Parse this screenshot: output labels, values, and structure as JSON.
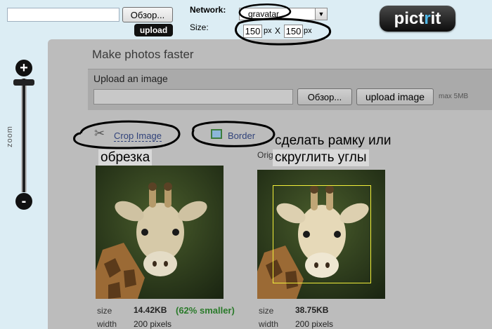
{
  "topbar": {
    "browse_label": "Обзор...",
    "upload_label": "upload",
    "network_label": "Network:",
    "network_value": "gravatar",
    "size_label": "Size:",
    "width_value": "150",
    "height_value": "150",
    "unit": "px",
    "separator": "X"
  },
  "logo": {
    "part1": "pict",
    "accent": "r",
    "part2": "it",
    "accent_color": "#4fb8e8"
  },
  "zoom": {
    "plus": "+",
    "minus": "-",
    "label": "zoom"
  },
  "panel": {
    "title": "Make photos faster",
    "upload_title": "Upload an image",
    "browse_label": "Обзор...",
    "upload_label": "upload image",
    "max_size": "max 5MB",
    "crop_link": "Crop Image",
    "border_link": "Border",
    "annotation_crop": "обрезка",
    "annotation_border_1": "сделать рамку или",
    "annotation_border_2": "скруглить углы",
    "orig_partial": "Orig",
    "left": {
      "size_label": "size",
      "size_value": "14.42KB",
      "smaller": "(62% smaller)",
      "width_label": "width",
      "width_value": "200 pixels"
    },
    "right": {
      "size_label": "size",
      "size_value": "38.75KB",
      "width_label": "width",
      "width_value": "200 pixels"
    }
  },
  "colors": {
    "page_bg": "#dcedf4",
    "panel_bg": "#bcbcbc",
    "link": "#30427a",
    "smaller": "#2a7a2a",
    "crop_frame": "#f2ef3a"
  }
}
